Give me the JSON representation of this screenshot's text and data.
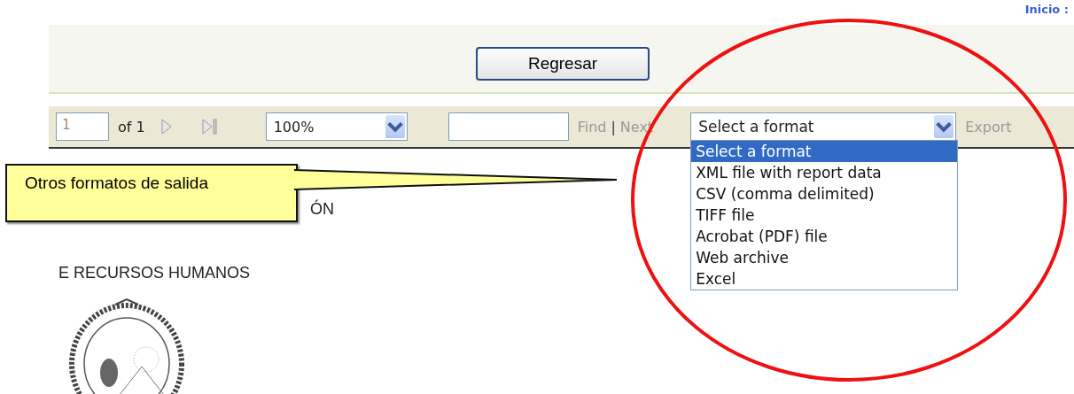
{
  "top_link": "Inicio :",
  "header": {
    "back_button": "Regresar"
  },
  "toolbar": {
    "page": "1",
    "page_count": "of 1",
    "zoom": "100%",
    "find": {
      "label": "Find",
      "disabled": true
    },
    "separator": "|",
    "next": {
      "label": "Next",
      "disabled": true
    },
    "export_format": "Select a format",
    "export": {
      "label": "Export",
      "disabled": true
    }
  },
  "format_dropdown": {
    "expanded": true,
    "options": [
      {
        "label": "Select a format",
        "selected": true
      },
      {
        "label": "XML file with report data",
        "selected": false
      },
      {
        "label": "CSV (comma delimited)",
        "selected": false
      },
      {
        "label": "TIFF file",
        "selected": false
      },
      {
        "label": "Acrobat (PDF) file",
        "selected": false
      },
      {
        "label": "Web archive",
        "selected": false
      },
      {
        "label": "Excel",
        "selected": false
      }
    ]
  },
  "report": {
    "lines": [
      "ÓN",
      "E RECURSOS HUMANOS"
    ]
  },
  "callout": {
    "text": "Otros formatos de salida"
  }
}
